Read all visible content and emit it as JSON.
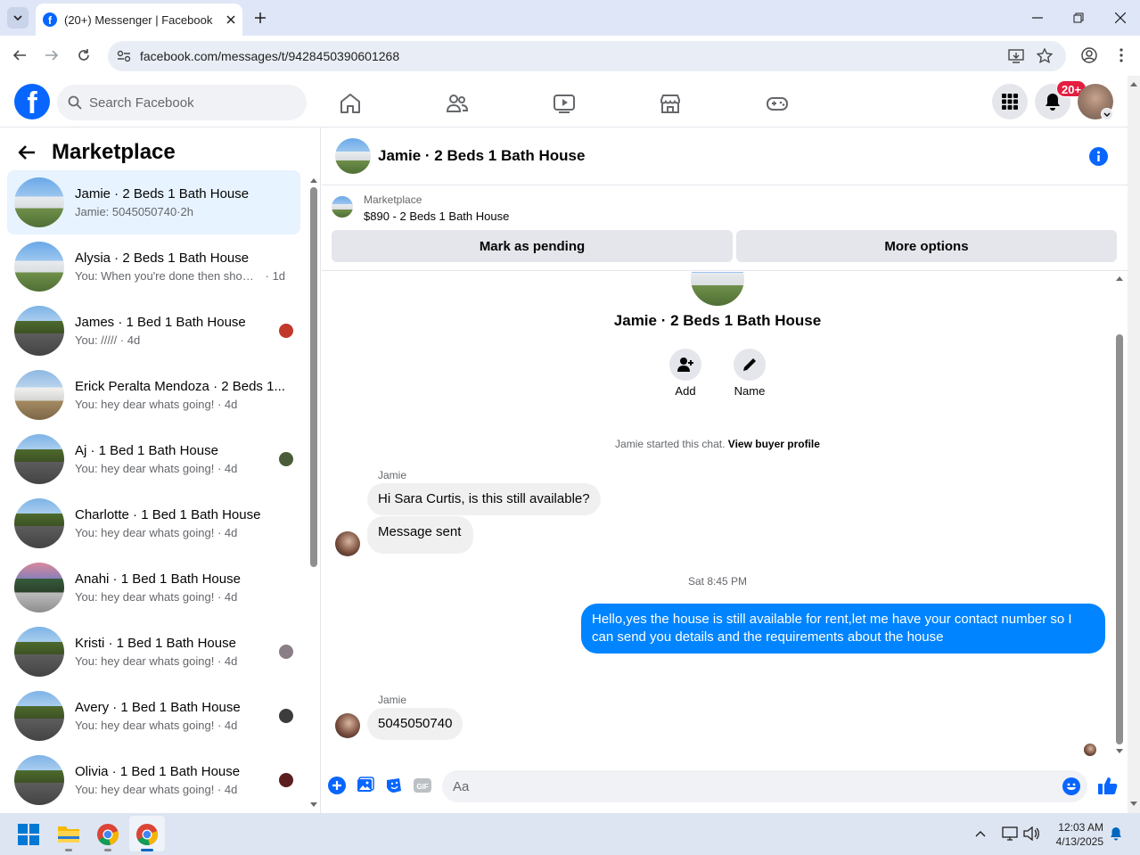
{
  "browser": {
    "tab_title": "(20+) Messenger | Facebook",
    "url": "facebook.com/messages/t/9428450390601268"
  },
  "header": {
    "search_placeholder": "Search Facebook",
    "notif_badge": "20+"
  },
  "sidebar": {
    "title": "Marketplace",
    "conversations": [
      {
        "name": "Jamie · 2 Beds 1 Bath House",
        "preview": "Jamie: 5045050740",
        "time": "2h",
        "active": true
      },
      {
        "name": "Alysia · 2 Beds 1 Bath House",
        "preview": "You: When you're done then show ...",
        "time": "1d"
      },
      {
        "name": "James · 1 Bed 1 Bath House",
        "preview": "You: /////",
        "time": "4d"
      },
      {
        "name": "Erick Peralta Mendoza · 2 Beds 1...",
        "preview": "You: hey dear whats going!",
        "time": "4d"
      },
      {
        "name": "Aj · 1 Bed 1 Bath House",
        "preview": "You: hey dear whats going!",
        "time": "4d"
      },
      {
        "name": "Charlotte · 1 Bed 1 Bath House",
        "preview": "You: hey dear whats going!",
        "time": "4d"
      },
      {
        "name": "Anahi · 1 Bed 1 Bath House",
        "preview": "You: hey dear whats going!",
        "time": "4d"
      },
      {
        "name": "Kristi · 1 Bed 1 Bath House",
        "preview": "You: hey dear whats going!",
        "time": "4d"
      },
      {
        "name": "Avery · 1 Bed 1 Bath House",
        "preview": "You: hey dear whats going!",
        "time": "4d"
      },
      {
        "name": "Olivia · 1 Bed 1 Bath House",
        "preview": "You: hey dear whats going!",
        "time": "4d"
      }
    ]
  },
  "chat": {
    "title": "Jamie · 2 Beds 1 Bath House",
    "listing_label": "Marketplace",
    "listing_detail": "$890 - 2 Beds 1 Bath House",
    "mark_pending": "Mark as pending",
    "more_options": "More options",
    "profile_name": "Jamie · 2 Beds 1 Bath House",
    "add_label": "Add",
    "name_label": "Name",
    "started_text": "Jamie started this chat.",
    "view_profile": "View buyer profile",
    "sender1": "Jamie",
    "msg1": "Hi Sara Curtis, is this still available?",
    "msg2": "Message sent",
    "timestamp": "Sat 8:45 PM",
    "msg3": "Hello,yes the house is still available for rent,let me have your contact number   so I can send you details and the requirements about the house",
    "sender2": "Jamie",
    "msg4": "5045050740",
    "composer_placeholder": "Aa"
  },
  "taskbar": {
    "time": "12:03 AM",
    "date": "4/13/2025"
  }
}
